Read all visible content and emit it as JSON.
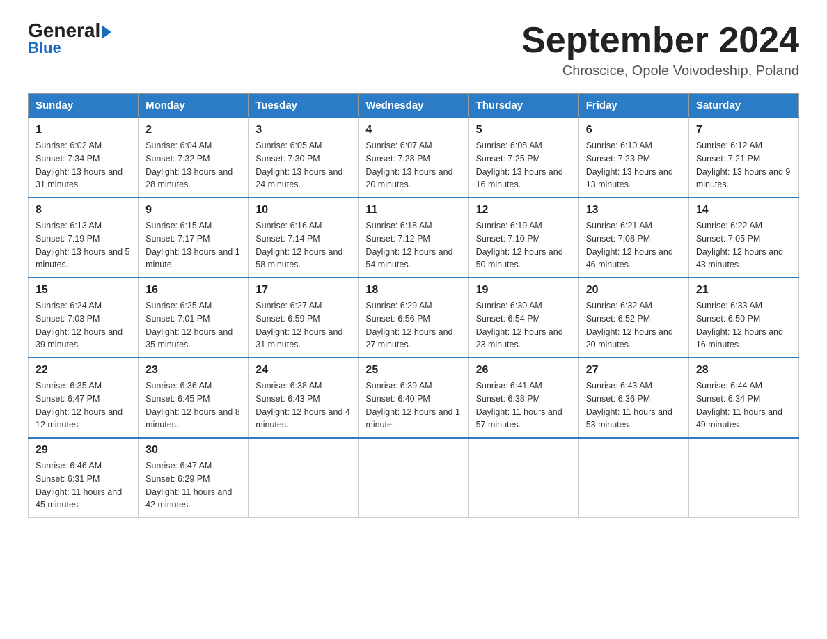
{
  "header": {
    "logo_general": "General",
    "logo_blue": "Blue",
    "month_title": "September 2024",
    "subtitle": "Chroscice, Opole Voivodeship, Poland"
  },
  "columns": [
    "Sunday",
    "Monday",
    "Tuesday",
    "Wednesday",
    "Thursday",
    "Friday",
    "Saturday"
  ],
  "weeks": [
    [
      {
        "day": "1",
        "sunrise": "6:02 AM",
        "sunset": "7:34 PM",
        "daylight": "13 hours and 31 minutes."
      },
      {
        "day": "2",
        "sunrise": "6:04 AM",
        "sunset": "7:32 PM",
        "daylight": "13 hours and 28 minutes."
      },
      {
        "day": "3",
        "sunrise": "6:05 AM",
        "sunset": "7:30 PM",
        "daylight": "13 hours and 24 minutes."
      },
      {
        "day": "4",
        "sunrise": "6:07 AM",
        "sunset": "7:28 PM",
        "daylight": "13 hours and 20 minutes."
      },
      {
        "day": "5",
        "sunrise": "6:08 AM",
        "sunset": "7:25 PM",
        "daylight": "13 hours and 16 minutes."
      },
      {
        "day": "6",
        "sunrise": "6:10 AM",
        "sunset": "7:23 PM",
        "daylight": "13 hours and 13 minutes."
      },
      {
        "day": "7",
        "sunrise": "6:12 AM",
        "sunset": "7:21 PM",
        "daylight": "13 hours and 9 minutes."
      }
    ],
    [
      {
        "day": "8",
        "sunrise": "6:13 AM",
        "sunset": "7:19 PM",
        "daylight": "13 hours and 5 minutes."
      },
      {
        "day": "9",
        "sunrise": "6:15 AM",
        "sunset": "7:17 PM",
        "daylight": "13 hours and 1 minute."
      },
      {
        "day": "10",
        "sunrise": "6:16 AM",
        "sunset": "7:14 PM",
        "daylight": "12 hours and 58 minutes."
      },
      {
        "day": "11",
        "sunrise": "6:18 AM",
        "sunset": "7:12 PM",
        "daylight": "12 hours and 54 minutes."
      },
      {
        "day": "12",
        "sunrise": "6:19 AM",
        "sunset": "7:10 PM",
        "daylight": "12 hours and 50 minutes."
      },
      {
        "day": "13",
        "sunrise": "6:21 AM",
        "sunset": "7:08 PM",
        "daylight": "12 hours and 46 minutes."
      },
      {
        "day": "14",
        "sunrise": "6:22 AM",
        "sunset": "7:05 PM",
        "daylight": "12 hours and 43 minutes."
      }
    ],
    [
      {
        "day": "15",
        "sunrise": "6:24 AM",
        "sunset": "7:03 PM",
        "daylight": "12 hours and 39 minutes."
      },
      {
        "day": "16",
        "sunrise": "6:25 AM",
        "sunset": "7:01 PM",
        "daylight": "12 hours and 35 minutes."
      },
      {
        "day": "17",
        "sunrise": "6:27 AM",
        "sunset": "6:59 PM",
        "daylight": "12 hours and 31 minutes."
      },
      {
        "day": "18",
        "sunrise": "6:29 AM",
        "sunset": "6:56 PM",
        "daylight": "12 hours and 27 minutes."
      },
      {
        "day": "19",
        "sunrise": "6:30 AM",
        "sunset": "6:54 PM",
        "daylight": "12 hours and 23 minutes."
      },
      {
        "day": "20",
        "sunrise": "6:32 AM",
        "sunset": "6:52 PM",
        "daylight": "12 hours and 20 minutes."
      },
      {
        "day": "21",
        "sunrise": "6:33 AM",
        "sunset": "6:50 PM",
        "daylight": "12 hours and 16 minutes."
      }
    ],
    [
      {
        "day": "22",
        "sunrise": "6:35 AM",
        "sunset": "6:47 PM",
        "daylight": "12 hours and 12 minutes."
      },
      {
        "day": "23",
        "sunrise": "6:36 AM",
        "sunset": "6:45 PM",
        "daylight": "12 hours and 8 minutes."
      },
      {
        "day": "24",
        "sunrise": "6:38 AM",
        "sunset": "6:43 PM",
        "daylight": "12 hours and 4 minutes."
      },
      {
        "day": "25",
        "sunrise": "6:39 AM",
        "sunset": "6:40 PM",
        "daylight": "12 hours and 1 minute."
      },
      {
        "day": "26",
        "sunrise": "6:41 AM",
        "sunset": "6:38 PM",
        "daylight": "11 hours and 57 minutes."
      },
      {
        "day": "27",
        "sunrise": "6:43 AM",
        "sunset": "6:36 PM",
        "daylight": "11 hours and 53 minutes."
      },
      {
        "day": "28",
        "sunrise": "6:44 AM",
        "sunset": "6:34 PM",
        "daylight": "11 hours and 49 minutes."
      }
    ],
    [
      {
        "day": "29",
        "sunrise": "6:46 AM",
        "sunset": "6:31 PM",
        "daylight": "11 hours and 45 minutes."
      },
      {
        "day": "30",
        "sunrise": "6:47 AM",
        "sunset": "6:29 PM",
        "daylight": "11 hours and 42 minutes."
      },
      null,
      null,
      null,
      null,
      null
    ]
  ]
}
